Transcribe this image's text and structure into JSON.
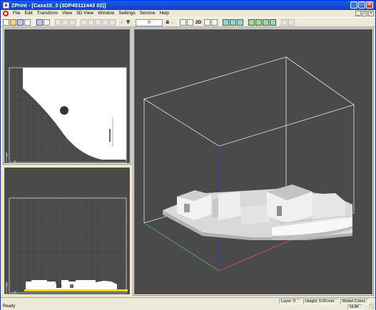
{
  "window": {
    "title": "ZPrint - [Casa15_3 (3DP45111443 02)]",
    "minimize_glyph": "_",
    "maximize_glyph": "□",
    "close_glyph": "×"
  },
  "menu": {
    "items": [
      "File",
      "Edit",
      "Transform",
      "View",
      "3D View",
      "Window",
      "Settings",
      "Service",
      "Help"
    ],
    "mdi_minimize": "_",
    "mdi_restore": "□",
    "mdi_close": "×"
  },
  "toolbar": {
    "layer_value": "0",
    "view_2d_label": "2D",
    "icons": [
      "new-icon",
      "open-icon",
      "save-icon",
      "print-icon",
      "cut-icon",
      "copy-icon",
      "paste-icon",
      "transform-icon",
      "arrow-up-icon",
      "double-arrow-up-icon",
      "arrow-down-icon",
      "zoom-in-icon",
      "zoom-out-icon",
      "zoom-fit-icon",
      "view-front-icon",
      "view-side-icon",
      "view-top-icon",
      "view-iso-icon",
      "render-icon"
    ]
  },
  "views": {
    "top_view": {
      "axis_x": "X",
      "axis_y": "Y"
    },
    "front_view": {
      "axis_x": "X",
      "axis_y": "Z"
    },
    "model_view": {}
  },
  "colors": {
    "viewport_bg": "#4a4a4a",
    "grid": "#5e5e5e",
    "build_box": "#e6e6e6",
    "axis_x": "#c03030",
    "axis_y": "#30a030",
    "axis_z": "#3040c0",
    "active_border": "#f2e3a0",
    "floor": "#ffd700"
  },
  "status": {
    "ready": "Ready",
    "layer": "Layer: 0",
    "height": "Height: 0.00 mm",
    "model_colors": "Model Colors",
    "num": "NUM"
  }
}
